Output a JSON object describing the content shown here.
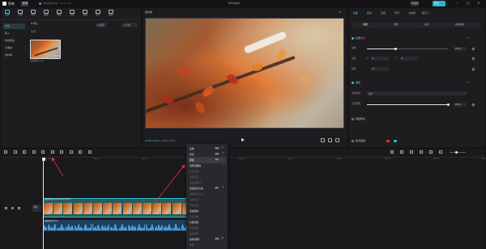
{
  "titlebar": {
    "app_name": "剪映",
    "menu_label": "菜单",
    "autosave": "自动保存本地：12:12:55",
    "window_title": "0314(4)",
    "shortcut_label": "快捷键",
    "export_label": "导出"
  },
  "toolbar": {
    "tools": [
      {
        "label": "媒体",
        "icon": "media-icon"
      },
      {
        "label": "音频",
        "icon": "audio-icon"
      },
      {
        "label": "文本",
        "icon": "text-icon"
      },
      {
        "label": "贴纸",
        "icon": "sticker-icon"
      },
      {
        "label": "特效",
        "icon": "effects-icon"
      },
      {
        "label": "转场",
        "icon": "transition-icon"
      },
      {
        "label": "滤镜",
        "icon": "filter-icon"
      },
      {
        "label": "调节",
        "icon": "adjust-icon"
      },
      {
        "label": "模板",
        "icon": "template-icon"
      }
    ]
  },
  "media": {
    "sidebar": [
      "本地",
      "导入",
      "我的预设",
      "云素材",
      "素材库"
    ],
    "import_label": "导入",
    "sort_label": "排序",
    "filter_label": "全部",
    "section_label": "全部",
    "clip_name": "视频素材.mp4",
    "thumb_duration": "00:18"
  },
  "player": {
    "title": "播放器",
    "time_current": "00:00:00:00",
    "time_total": "00:00:18:05"
  },
  "inspector": {
    "tabs": [
      "画面",
      "变速",
      "动画",
      "调节",
      "AI效果",
      "数字人"
    ],
    "subtabs": [
      "基础",
      "抠像",
      "蒙版",
      "美颜美体"
    ],
    "transform_label": "位置大小",
    "scale_label": "缩放",
    "scale_value": "100%",
    "scale_fraction": 0.35,
    "position_label": "位置",
    "pos_x": "0",
    "pos_y": "0",
    "rotate_label": "旋转",
    "rotate_value": "0°",
    "blend_label": "混合",
    "blend_mode_label": "混合模式",
    "blend_mode_value": "正常",
    "opacity_label": "不透明度",
    "opacity_value": "100%",
    "opacity_fraction": 1.0,
    "stabilize_label": "视频防抖",
    "enhance_label": "超清画质"
  },
  "timeline": {
    "ticks": [
      "00:00",
      "00:05",
      "00:10",
      "00:15",
      "00:20",
      "00:25",
      "00:30",
      "00:35",
      "00:40",
      "00:45"
    ],
    "cover_label": "封面",
    "video_clip_label": "视频素材.mp4 00:00:18:05",
    "audio_clip_label": "视频素材.mp4"
  },
  "context_menu": {
    "items": [
      {
        "label": "复制",
        "key": "Ctrl",
        "key2": "C",
        "disabled": false
      },
      {
        "label": "剪切",
        "key": "Ctrl",
        "key2": "X",
        "disabled": false
      },
      {
        "label": "删除",
        "key": "Del",
        "key2": "",
        "disabled": false,
        "hover": true
      },
      {
        "label": "选择宽跟随",
        "key": "",
        "key2": "",
        "disabled": false,
        "submenu": true
      },
      {
        "label": "分离音频",
        "key": "",
        "key2": "",
        "disabled": true
      },
      {
        "label": "识别字幕",
        "key": "",
        "key2": "",
        "disabled": true
      },
      {
        "label": "添加关键帧",
        "key": "",
        "key2": "",
        "disabled": true
      },
      {
        "label": "新建复合片段",
        "key": "Alt",
        "key2": "G",
        "disabled": false
      },
      {
        "label": "解除复合片段",
        "key": "",
        "key2": "",
        "disabled": true
      },
      {
        "label": "替换片段",
        "key": "",
        "key2": "",
        "disabled": true
      },
      {
        "label": "导出片段",
        "key": "",
        "key2": "",
        "disabled": true
      },
      {
        "label": "链接媒体",
        "key": "",
        "key2": "",
        "disabled": false
      },
      {
        "label": "分离音频",
        "key": "",
        "key2": "",
        "disabled": true
      },
      {
        "label": "智能调色",
        "key": "",
        "key2": "",
        "disabled": false,
        "submenu": true
      },
      {
        "label": "视频定格",
        "key": "",
        "key2": "",
        "disabled": true
      },
      {
        "label": "链接媒体",
        "key": "",
        "key2": "",
        "disabled": true
      },
      {
        "label": "启用/禁用",
        "key": "Ctrl",
        "key2": "B",
        "disabled": false
      },
      {
        "label": "隐藏",
        "key": "",
        "key2": "",
        "disabled": true
      }
    ]
  },
  "colors": {
    "accent": "#35c3d4",
    "annotation": "#e03030"
  }
}
